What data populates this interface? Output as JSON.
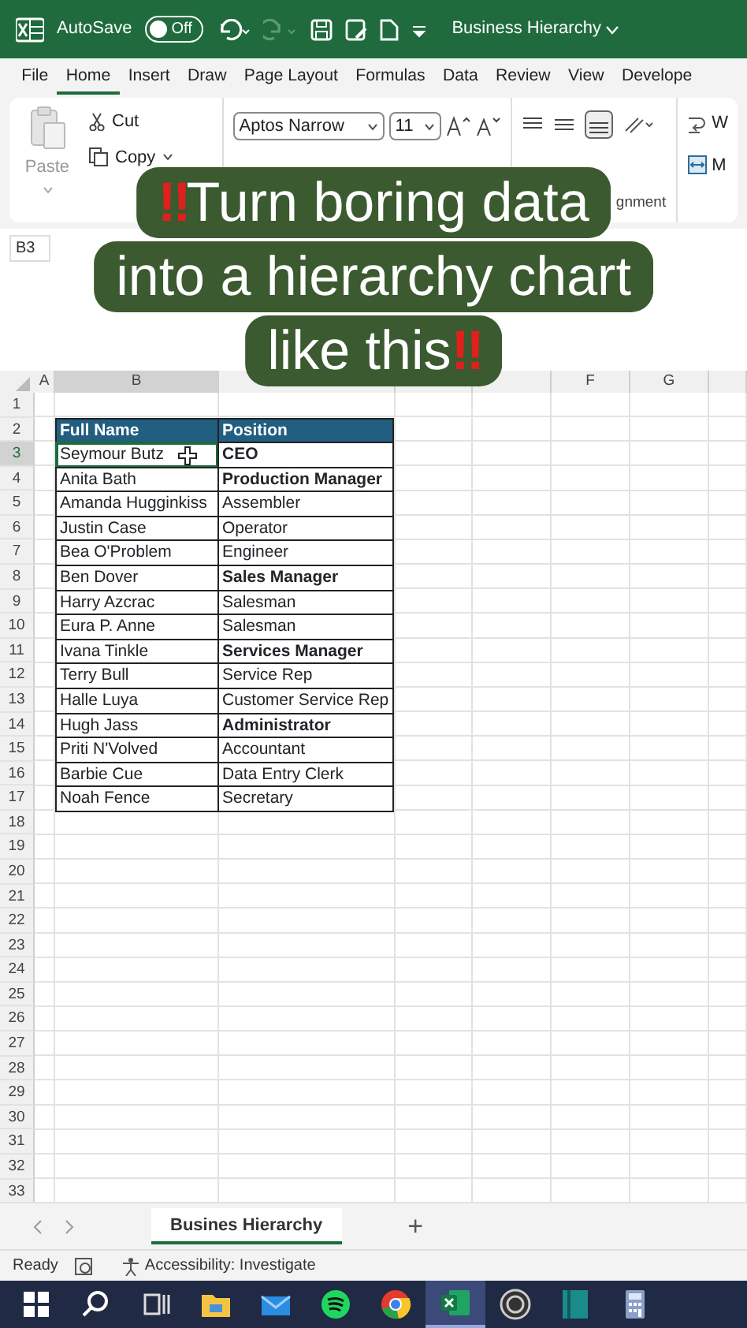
{
  "title_bar": {
    "autosave_label": "AutoSave",
    "autosave_toggle": {
      "label": "Off",
      "on": false
    },
    "redo_disabled": true,
    "document_title": "Business Hierarchy"
  },
  "menu_tabs": [
    {
      "label": "File",
      "selected": false
    },
    {
      "label": "Home",
      "selected": true
    },
    {
      "label": "Insert",
      "selected": false
    },
    {
      "label": "Draw",
      "selected": false
    },
    {
      "label": "Page Layout",
      "selected": false
    },
    {
      "label": "Formulas",
      "selected": false
    },
    {
      "label": "Data",
      "selected": false
    },
    {
      "label": "Review",
      "selected": false
    },
    {
      "label": "View",
      "selected": false
    },
    {
      "label": "Develope",
      "selected": false
    }
  ],
  "ribbon": {
    "paste_label": "Paste",
    "cut_label": "Cut",
    "copy_label": "Copy",
    "font_name": "Aptos Narrow",
    "font_size": "11",
    "alignment_group_label": "gnment",
    "wrap_label": "W",
    "merge_label": "M"
  },
  "name_box": "B3",
  "caption": {
    "lead_mark": "‼",
    "text": "Turn boring data\ninto a hierarchy chart\nlike this",
    "trail_mark": "‼"
  },
  "column_headers": [
    "A",
    "B",
    "F",
    "G"
  ],
  "row_numbers": [
    "1",
    "2",
    "3",
    "4",
    "5",
    "6",
    "7",
    "8",
    "9",
    "10",
    "11",
    "12",
    "13",
    "14",
    "15",
    "16",
    "17",
    "18",
    "19",
    "20",
    "21",
    "22",
    "23",
    "24",
    "25",
    "26",
    "27",
    "28",
    "29",
    "30",
    "31",
    "32",
    "33"
  ],
  "table": {
    "columns": [
      "Full Name",
      "Position"
    ],
    "rows": [
      {
        "name": "Seymour Butz",
        "position": "CEO",
        "bold": true,
        "selected": true
      },
      {
        "name": "Anita Bath",
        "position": "Production Manager",
        "bold": true,
        "selected": false
      },
      {
        "name": "Amanda Hugginkiss",
        "position": "Assembler",
        "bold": false,
        "selected": false
      },
      {
        "name": "Justin Case",
        "position": "Operator",
        "bold": false,
        "selected": false
      },
      {
        "name": "Bea O'Problem",
        "position": "Engineer",
        "bold": false,
        "selected": false
      },
      {
        "name": "Ben Dover",
        "position": "Sales Manager",
        "bold": true,
        "selected": false
      },
      {
        "name": "Harry Azcrac",
        "position": "Salesman",
        "bold": false,
        "selected": false
      },
      {
        "name": "Eura P. Anne",
        "position": "Salesman",
        "bold": false,
        "selected": false
      },
      {
        "name": "Ivana Tinkle",
        "position": "Services Manager",
        "bold": true,
        "selected": false
      },
      {
        "name": "Terry Bull",
        "position": "Service Rep",
        "bold": false,
        "selected": false
      },
      {
        "name": "Halle Luya",
        "position": "Customer Service Rep",
        "bold": false,
        "selected": false
      },
      {
        "name": "Hugh Jass",
        "position": "Administrator",
        "bold": true,
        "selected": false
      },
      {
        "name": "Priti N'Volved",
        "position": "Accountant",
        "bold": false,
        "selected": false
      },
      {
        "name": "Barbie Cue",
        "position": "Data Entry Clerk",
        "bold": false,
        "selected": false
      },
      {
        "name": "Noah Fence",
        "position": "Secretary",
        "bold": false,
        "selected": false
      }
    ]
  },
  "sheet_tabs": [
    {
      "label": "Busines Hierarchy",
      "selected": true
    }
  ],
  "add_sheet": "+",
  "status_bar": {
    "ready": "Ready",
    "accessibility": "Accessibility: Investigate"
  },
  "taskbar": [
    {
      "kind": "start",
      "active": false
    },
    {
      "kind": "search",
      "active": false
    },
    {
      "kind": "taskview",
      "active": false
    },
    {
      "kind": "folder",
      "active": false
    },
    {
      "kind": "mail",
      "active": false
    },
    {
      "kind": "music",
      "active": false
    },
    {
      "kind": "browser",
      "active": false
    },
    {
      "kind": "excel",
      "active": true
    },
    {
      "kind": "recorder",
      "active": false
    },
    {
      "kind": "book",
      "active": false
    },
    {
      "kind": "calculator",
      "active": false
    }
  ]
}
